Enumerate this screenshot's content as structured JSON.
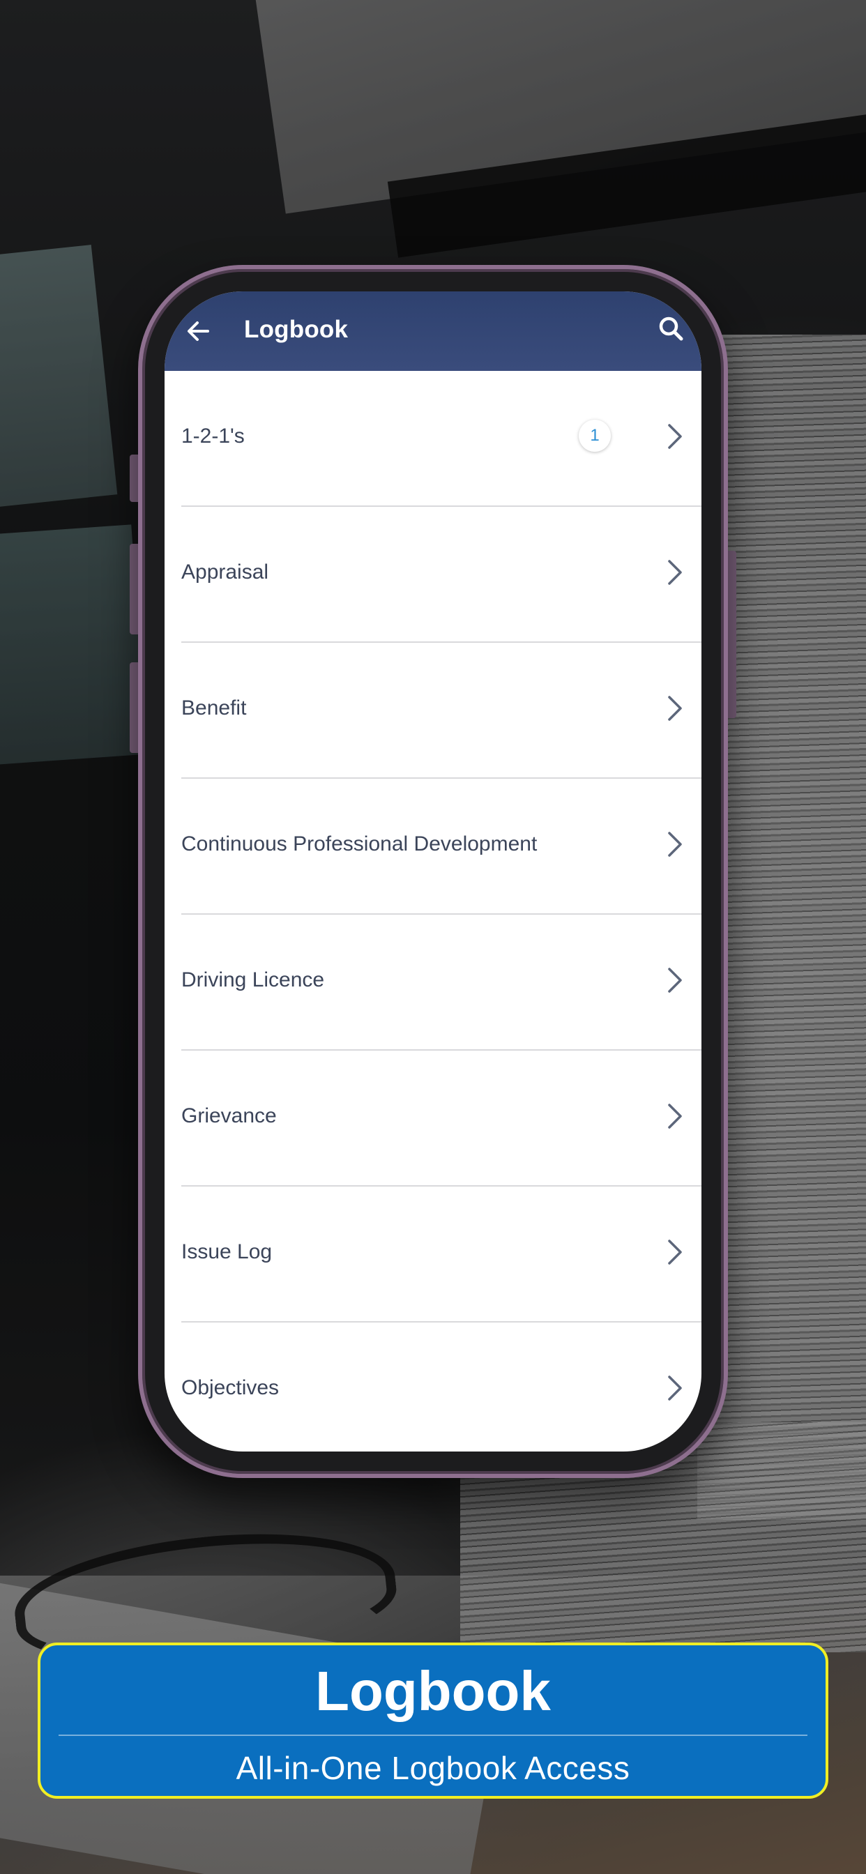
{
  "header": {
    "title": "Logbook",
    "back_icon": "arrow-left-icon",
    "search_icon": "search-icon"
  },
  "list": {
    "items": [
      {
        "label": "1-2-1's",
        "badge": "1"
      },
      {
        "label": "Appraisal"
      },
      {
        "label": "Benefit"
      },
      {
        "label": "Continuous Professional Development"
      },
      {
        "label": "Driving Licence"
      },
      {
        "label": "Grievance"
      },
      {
        "label": "Issue Log"
      },
      {
        "label": "Objectives"
      }
    ],
    "chevron_icon": "chevron-right-icon"
  },
  "banner": {
    "title": "Logbook",
    "subtitle": "All-in-One Logbook Access"
  },
  "colors": {
    "appbar": "#2e416f",
    "badge_text": "#2c8fd4",
    "banner_bg": "#0a6fbf",
    "banner_border": "#f0ee24"
  }
}
